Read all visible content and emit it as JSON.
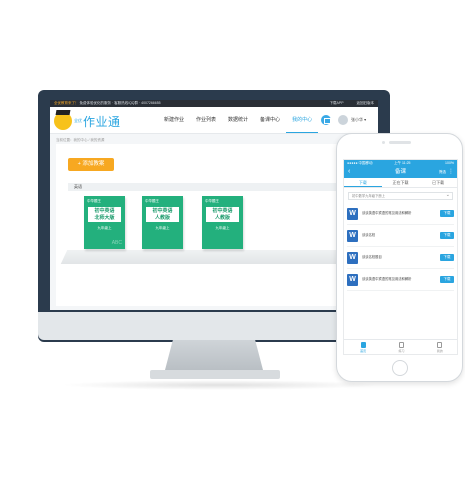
{
  "desktop": {
    "topbar": {
      "notice": "全优教育来了！",
      "info": "免费体验优化的服务 · 客服热线/QQ群 · 4007266655",
      "app_link": "下载APP",
      "back_link": "返回旧版本"
    },
    "logo": {
      "small": "全优",
      "big": "作业通"
    },
    "nav": [
      "新建作业",
      "作业列表",
      "数据统计",
      "备课中心",
      "我的中心"
    ],
    "user": {
      "name": "张小华 ▾"
    },
    "breadcrumb": "当前位置：我的中心 / 我的资源",
    "add_button": "+ 添加教案",
    "section_title": "英语",
    "books": [
      {
        "tag": "中华题王",
        "title": [
          "初中英语",
          "北师大版"
        ],
        "grade": "九年级上"
      },
      {
        "tag": "中华题王",
        "title": [
          "初中英语",
          "人教版"
        ],
        "grade": "九年级上"
      },
      {
        "tag": "中华题王",
        "title": [
          "初中英语",
          "人教版"
        ],
        "grade": "九年级上"
      }
    ],
    "book_watermark": "ABC"
  },
  "phone": {
    "status": {
      "carrier": "●●●●● 中国移动",
      "time": "上午 11:25",
      "battery": "100%"
    },
    "title": "备课",
    "switch_label": "筛选",
    "tabs": [
      "下载",
      "正在下载",
      "已下载"
    ],
    "select_placeholder": "初中数学九年级下册上",
    "items": [
      {
        "icon": "W",
        "text": "谈谈英语中宾语的常见用法和解析",
        "button": "下载"
      },
      {
        "icon": "W",
        "text": "谈谈名校",
        "button": "下载"
      },
      {
        "icon": "W",
        "text": "谈谈名校题目",
        "button": "下载"
      },
      {
        "icon": "W",
        "text": "谈谈英语中宾语的常见用法和解析",
        "button": "下载"
      }
    ],
    "bottom_nav": [
      "首页",
      "练习",
      "我的"
    ]
  },
  "colors": {
    "accent": "#2aa5e0",
    "orange": "#f7a821",
    "book_green": "#23b07d",
    "monitor": "#2b3b4d",
    "word_blue": "#2d6fbf"
  }
}
